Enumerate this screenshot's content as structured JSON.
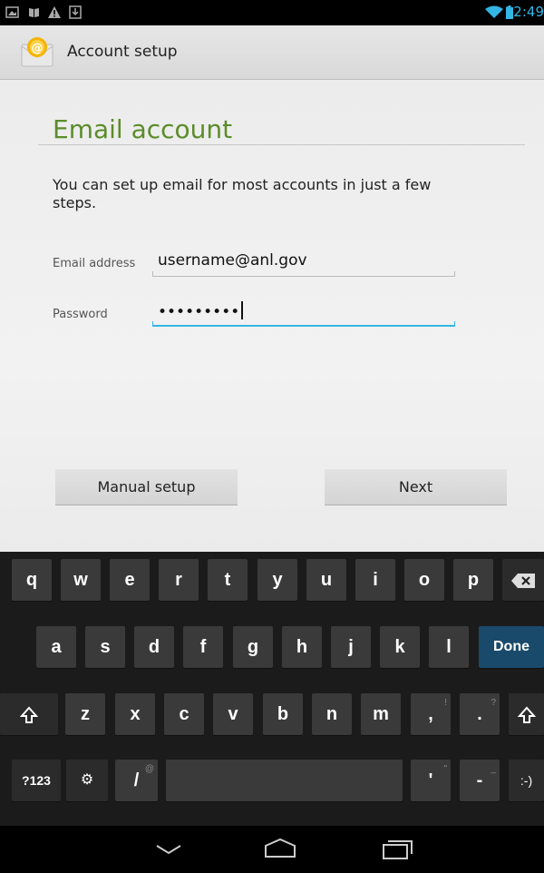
{
  "status_bar": {
    "time": "12:49",
    "icons": [
      "gallery-icon",
      "book-icon",
      "warning-icon",
      "download-icon",
      "wifi-icon",
      "battery-icon"
    ]
  },
  "action_bar": {
    "title": "Account setup",
    "app_icon": "email-icon"
  },
  "form": {
    "heading": "Email account",
    "intro": "You can set up email for most accounts in just a few steps.",
    "email_label": "Email address",
    "email_value": "username@anl.gov",
    "password_label": "Password",
    "password_value": "•••••••••"
  },
  "buttons": {
    "manual_setup": "Manual setup",
    "next": "Next"
  },
  "keyboard": {
    "row1": [
      "q",
      "w",
      "e",
      "r",
      "t",
      "y",
      "u",
      "i",
      "o",
      "p"
    ],
    "row2": [
      "a",
      "s",
      "d",
      "f",
      "g",
      "h",
      "j",
      "k",
      "l"
    ],
    "done": "Done",
    "row3": [
      "z",
      "x",
      "c",
      "v",
      "b",
      "n",
      "m",
      ",",
      "."
    ],
    "row3_hints": [
      "",
      "",
      "",
      "",
      "",
      "",
      "",
      "!",
      "?"
    ],
    "symbols": "?123",
    "settings_glyph": "⚙",
    "slash": "/",
    "slash_hint": "@",
    "apostrophe": "'",
    "apostrophe_hint": "\"",
    "dash": "-",
    "dash_hint": "_",
    "smiley": ":-)"
  },
  "colors": {
    "heading_green": "#5b8c2a",
    "focus_blue": "#33b5e5",
    "done_key": "#1a4a6b"
  }
}
